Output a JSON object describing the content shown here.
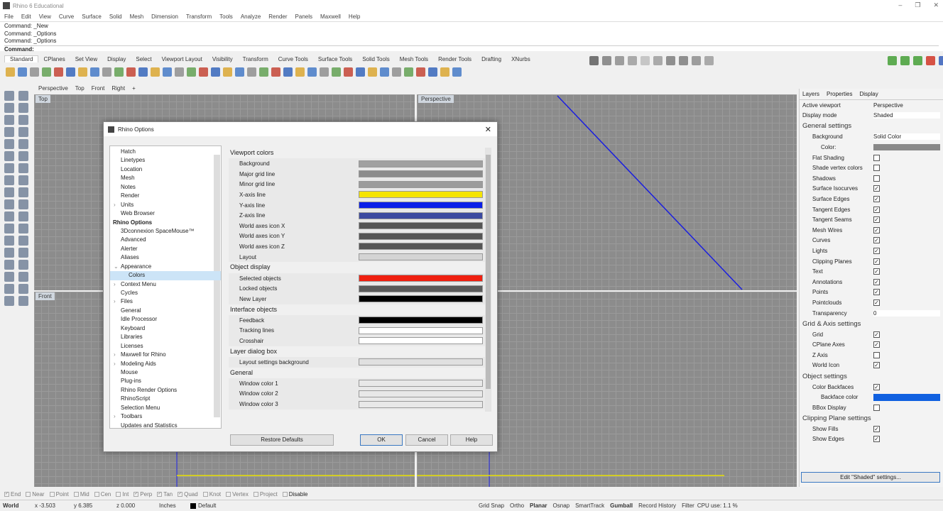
{
  "app": {
    "title": "Rhino 6 Educational"
  },
  "menu": [
    "File",
    "Edit",
    "View",
    "Curve",
    "Surface",
    "Solid",
    "Mesh",
    "Dimension",
    "Transform",
    "Tools",
    "Analyze",
    "Render",
    "Panels",
    "Maxwell",
    "Help"
  ],
  "command": {
    "history": [
      "Command: _New",
      "Command: _Options",
      "Command: _Options"
    ],
    "prompt": "Command:"
  },
  "toolbar_tabs": [
    "Standard",
    "CPlanes",
    "Set View",
    "Display",
    "Select",
    "Viewport Layout",
    "Visibility",
    "Transform",
    "Curve Tools",
    "Surface Tools",
    "Solid Tools",
    "Mesh Tools",
    "Render Tools",
    "Drafting",
    "XNurbs"
  ],
  "viewport_tabs": [
    "Perspective",
    "Top",
    "Front",
    "Right",
    "+"
  ],
  "viewports": {
    "top": "Top",
    "perspective": "Perspective",
    "front": "Front"
  },
  "right_panel": {
    "tabs": [
      "Layers",
      "Properties",
      "Display"
    ],
    "active_viewport_label": "Active viewport",
    "active_viewport": "Perspective",
    "display_mode_label": "Display mode",
    "display_mode": "Shaded",
    "general": "General settings",
    "background_label": "Background",
    "background": "Solid Color",
    "color_label": "Color:",
    "general_items": [
      {
        "label": "Flat Shading",
        "checked": false
      },
      {
        "label": "Shade vertex colors",
        "checked": false
      },
      {
        "label": "Shadows",
        "checked": false
      },
      {
        "label": "Surface Isocurves",
        "checked": true
      },
      {
        "label": "Surface Edges",
        "checked": true
      },
      {
        "label": "Tangent Edges",
        "checked": true
      },
      {
        "label": "Tangent Seams",
        "checked": true
      },
      {
        "label": "Mesh Wires",
        "checked": true
      },
      {
        "label": "Curves",
        "checked": true
      },
      {
        "label": "Lights",
        "checked": true
      },
      {
        "label": "Clipping Planes",
        "checked": true
      },
      {
        "label": "Text",
        "checked": true
      },
      {
        "label": "Annotations",
        "checked": true
      },
      {
        "label": "Points",
        "checked": true
      },
      {
        "label": "Pointclouds",
        "checked": true
      }
    ],
    "transparency_label": "Transparency",
    "transparency": "0",
    "grid": "Grid & Axis settings",
    "grid_items": [
      {
        "label": "Grid",
        "checked": true
      },
      {
        "label": "CPlane Axes",
        "checked": true
      },
      {
        "label": "Z Axis",
        "checked": false
      },
      {
        "label": "World Icon",
        "checked": true
      }
    ],
    "object": "Object settings",
    "color_backfaces_label": "Color Backfaces",
    "backface_color_label": "Backface color",
    "bbox_label": "BBox Display",
    "backface_color": "#1060e0",
    "clipping": "Clipping Plane settings",
    "clip_items": [
      {
        "label": "Show Fills",
        "checked": true
      },
      {
        "label": "Show Edges",
        "checked": true
      }
    ],
    "edit_button": "Edit \"Shaded\" settings..."
  },
  "snaps": [
    {
      "label": "End",
      "checked": true
    },
    {
      "label": "Near",
      "checked": false
    },
    {
      "label": "Point",
      "checked": false
    },
    {
      "label": "Mid",
      "checked": false
    },
    {
      "label": "Cen",
      "checked": false
    },
    {
      "label": "Int",
      "checked": false
    },
    {
      "label": "Perp",
      "checked": true
    },
    {
      "label": "Tan",
      "checked": true
    },
    {
      "label": "Quad",
      "checked": true
    },
    {
      "label": "Knot",
      "checked": false
    },
    {
      "label": "Vertex",
      "checked": false
    },
    {
      "label": "Project",
      "checked": false
    },
    {
      "label": "Disable",
      "checked": false
    }
  ],
  "status": {
    "cplane": "World",
    "x": "x -3.503",
    "y": "y 6.385",
    "z": "z 0.000",
    "units": "Inches",
    "layer": "Default",
    "items": [
      "Grid Snap",
      "Ortho",
      "Planar",
      "Osnap",
      "SmartTrack",
      "Gumball",
      "Record History",
      "Filter"
    ],
    "cpu": "CPU use: 1.1 %"
  },
  "dialog": {
    "title": "Rhino Options",
    "tree": [
      {
        "label": "Hatch"
      },
      {
        "label": "Linetypes"
      },
      {
        "label": "Location"
      },
      {
        "label": "Mesh"
      },
      {
        "label": "Notes"
      },
      {
        "label": "Render"
      },
      {
        "label": "Units",
        "arrow": ">"
      },
      {
        "label": "Web Browser"
      },
      {
        "label": "Rhino Options",
        "bold": true
      },
      {
        "label": "3Dconnexion SpaceMouse™"
      },
      {
        "label": "Advanced"
      },
      {
        "label": "Alerter"
      },
      {
        "label": "Aliases"
      },
      {
        "label": "Appearance",
        "arrow": "v"
      },
      {
        "label": "Colors",
        "selected": true
      },
      {
        "label": "Context Menu",
        "arrow": ">"
      },
      {
        "label": "Cycles"
      },
      {
        "label": "Files",
        "arrow": ">"
      },
      {
        "label": "General"
      },
      {
        "label": "Idle Processor"
      },
      {
        "label": "Keyboard"
      },
      {
        "label": "Libraries"
      },
      {
        "label": "Licenses"
      },
      {
        "label": "Maxwell for Rhino",
        "arrow": ">"
      },
      {
        "label": "Modeling Aids",
        "arrow": ">"
      },
      {
        "label": "Mouse"
      },
      {
        "label": "Plug-ins"
      },
      {
        "label": "Rhino Render Options"
      },
      {
        "label": "RhinoScript"
      },
      {
        "label": "Selection Menu"
      },
      {
        "label": "Toolbars",
        "arrow": ">"
      },
      {
        "label": "Updates and Statistics"
      }
    ],
    "sections": [
      {
        "title": "Viewport colors",
        "rows": [
          {
            "label": "Background",
            "color": "#a0a0a0"
          },
          {
            "label": "Major grid line",
            "color": "#8c8c8c"
          },
          {
            "label": "Minor grid line",
            "color": "#9c9c9c"
          },
          {
            "label": "X-axis line",
            "color": "#f5e400"
          },
          {
            "label": "Y-axis line",
            "color": "#0a1ee8"
          },
          {
            "label": "Z-axis line",
            "color": "#3c4aa0"
          },
          {
            "label": "World axes icon X",
            "color": "#555555"
          },
          {
            "label": "World axes icon Y",
            "color": "#555555"
          },
          {
            "label": "World axes icon Z",
            "color": "#555555"
          },
          {
            "label": "Layout",
            "color": "#d4d4d4"
          }
        ]
      },
      {
        "title": "Object display",
        "rows": [
          {
            "label": "Selected objects",
            "color": "#f02010"
          },
          {
            "label": "Locked objects",
            "color": "#5a5a5a"
          },
          {
            "label": "New Layer",
            "color": "#000000"
          }
        ]
      },
      {
        "title": "Interface objects",
        "rows": [
          {
            "label": "Feedback",
            "color": "#000000"
          },
          {
            "label": "Tracking lines",
            "color": "#ffffff"
          },
          {
            "label": "Crosshair",
            "color": "#ffffff"
          }
        ]
      },
      {
        "title": "Layer dialog box",
        "rows": [
          {
            "label": "Layout settings background",
            "color": "#e0e0e0"
          }
        ]
      },
      {
        "title": "General",
        "rows": [
          {
            "label": "Window color 1",
            "color": "#e8e8e8"
          },
          {
            "label": "Window color 2",
            "color": "#e8e8e8"
          },
          {
            "label": "Window color 3",
            "color": "#e8e8e8"
          }
        ]
      }
    ],
    "restore": "Restore Defaults",
    "ok": "OK",
    "cancel": "Cancel",
    "help": "Help"
  }
}
